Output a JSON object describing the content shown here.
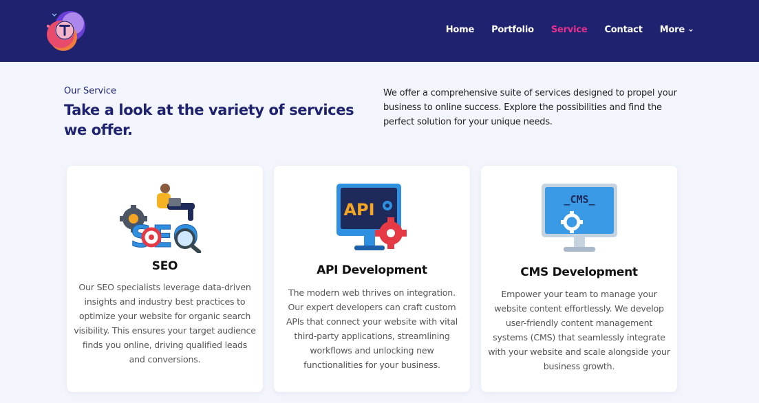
{
  "nav": {
    "items": [
      {
        "label": "Home"
      },
      {
        "label": "Portfolio"
      },
      {
        "label": "Service"
      },
      {
        "label": "Contact"
      },
      {
        "label": "More"
      }
    ],
    "active": "Service"
  },
  "hero": {
    "eyebrow": "Our Service",
    "headline": "Take a look at the variety of services we offer.",
    "intro": "We offer a comprehensive suite of services designed to propel your business to online success. Explore the possibilities and find the perfect solution for your unique needs."
  },
  "cards": [
    {
      "title": "SEO",
      "icon": "seo-illustration-icon",
      "text": "Our SEO specialists leverage data-driven insights and industry best practices to optimize your website for organic search visibility. This ensures your target audience finds you online, driving qualified leads and conversions."
    },
    {
      "title": "API Development",
      "icon": "api-monitor-icon",
      "text": "The modern web thrives on integration. Our expert developers can craft custom APIs that connect your website with vital third-party applications, streamlining workflows and unlocking new functionalities for your business."
    },
    {
      "title": "CMS Development",
      "icon": "cms-monitor-icon",
      "text": "Empower your team to manage your website content effortlessly. We develop user-friendly content management systems (CMS) that seamlessly integrate with your website and scale alongside your business growth."
    }
  ],
  "illustration_text": {
    "seo": "SEO",
    "api": "API",
    "cms": "_CMS_"
  },
  "colors": {
    "header_bg": "#1e226f",
    "accent": "#e8308c",
    "page_bg": "#f2f5fc"
  }
}
